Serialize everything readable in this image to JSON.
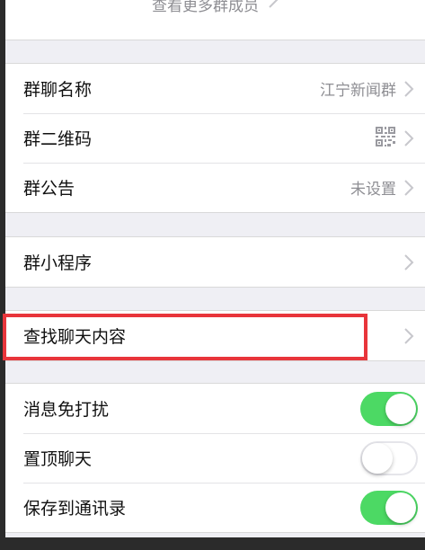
{
  "top": {
    "view_more_members": "查看更多群成员"
  },
  "info_group": [
    {
      "label": "群聊名称",
      "value": "江宁新闻群"
    },
    {
      "label": "群二维码",
      "icon": "qr-code-icon"
    },
    {
      "label": "群公告",
      "value": "未设置"
    }
  ],
  "mini_program": {
    "label": "群小程序"
  },
  "search": {
    "label": "查找聊天内容"
  },
  "toggles": [
    {
      "label": "消息免打扰",
      "on": true
    },
    {
      "label": "置顶聊天",
      "on": false
    },
    {
      "label": "保存到通讯录",
      "on": true
    }
  ],
  "colors": {
    "toggle_on": "#4cd964",
    "highlight": "#e8353b",
    "background": "#efeff4"
  }
}
